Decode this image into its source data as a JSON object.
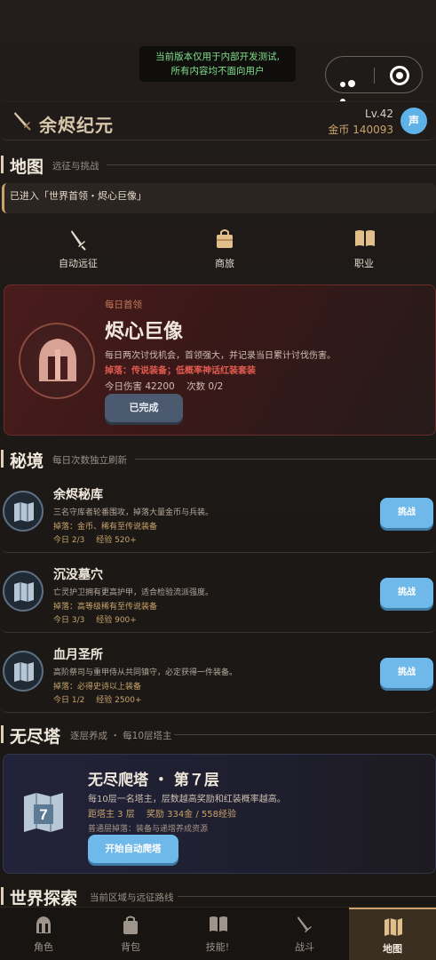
{
  "notice": {
    "line1": "当前版本仅用于内部开发测试,",
    "line2": "所有内容均不面向用户"
  },
  "header": {
    "app_title": "余烬纪元",
    "level": "Lv.42",
    "gold": "金币 140093",
    "sound_label": "声"
  },
  "map_section": {
    "title": "地图",
    "subtitle": "远征与挑战",
    "entered": "已进入「世界首领・烬心巨像」",
    "quick": [
      {
        "label": "自动远征",
        "icon": "sword-icon"
      },
      {
        "label": "商旅",
        "icon": "bag-icon"
      },
      {
        "label": "职业",
        "icon": "book-icon"
      }
    ]
  },
  "boss": {
    "tag": "每日首领",
    "name": "烬心巨像",
    "desc": "每日两次讨伐机会，首领强大，并记录当日累计讨伐伤害。",
    "drop": "掉落：传说装备；低概率神话红装套装",
    "damage": "今日伤害 42200",
    "times": "次数 0/2",
    "button": "已完成"
  },
  "realm_section": {
    "title": "秘境",
    "subtitle": "每日次数独立刷新",
    "items": [
      {
        "name": "余烬秘库",
        "desc": "三名守库者轮番围攻，掉落大量金币与兵装。",
        "drop": "掉落：金币、稀有至传说装备",
        "today": "今日 2/3",
        "exp": "经验 520+",
        "button": "挑战"
      },
      {
        "name": "沉没墓穴",
        "desc": "亡灵护卫拥有更高护甲，适合检验流派强度。",
        "drop": "掉落：高等级稀有至传说装备",
        "today": "今日 3/3",
        "exp": "经验 900+",
        "button": "挑战"
      },
      {
        "name": "血月圣所",
        "desc": "高阶祭司与重甲侍从共同镇守，必定获得一件装备。",
        "drop": "掉落：必得史诗以上装备",
        "today": "今日 1/2",
        "exp": "经验 2500+",
        "button": "挑战"
      }
    ]
  },
  "tower_section": {
    "title": "无尽塔",
    "subtitle": "逐层养成 ・ 每10层塔主",
    "name": "无尽爬塔 ・ 第７层",
    "floor_badge": "7",
    "desc": "每10层一名塔主，层数越高奖励和红装概率越高。",
    "boss_floor": "距塔主 3 层",
    "reward": "奖励 334金 / 558经验",
    "drop": "普通层掉落：装备与递增养成资源",
    "button": "开始自动爬塔"
  },
  "world_section": {
    "title": "世界探索",
    "subtitle": "当前区域与远征路线"
  },
  "tabs": [
    {
      "label": "角色",
      "icon": "helmet-icon"
    },
    {
      "label": "背包",
      "icon": "backpack-icon"
    },
    {
      "label": "技能!",
      "icon": "book-icon"
    },
    {
      "label": "战斗",
      "icon": "sword-icon"
    },
    {
      "label": "地图",
      "icon": "map-icon",
      "active": true
    }
  ],
  "colors": {
    "accent_gold": "#c9a36b",
    "button_blue": "#6fb8ea",
    "boss_red": "#e25b4f",
    "notice_green": "#7fe089"
  }
}
